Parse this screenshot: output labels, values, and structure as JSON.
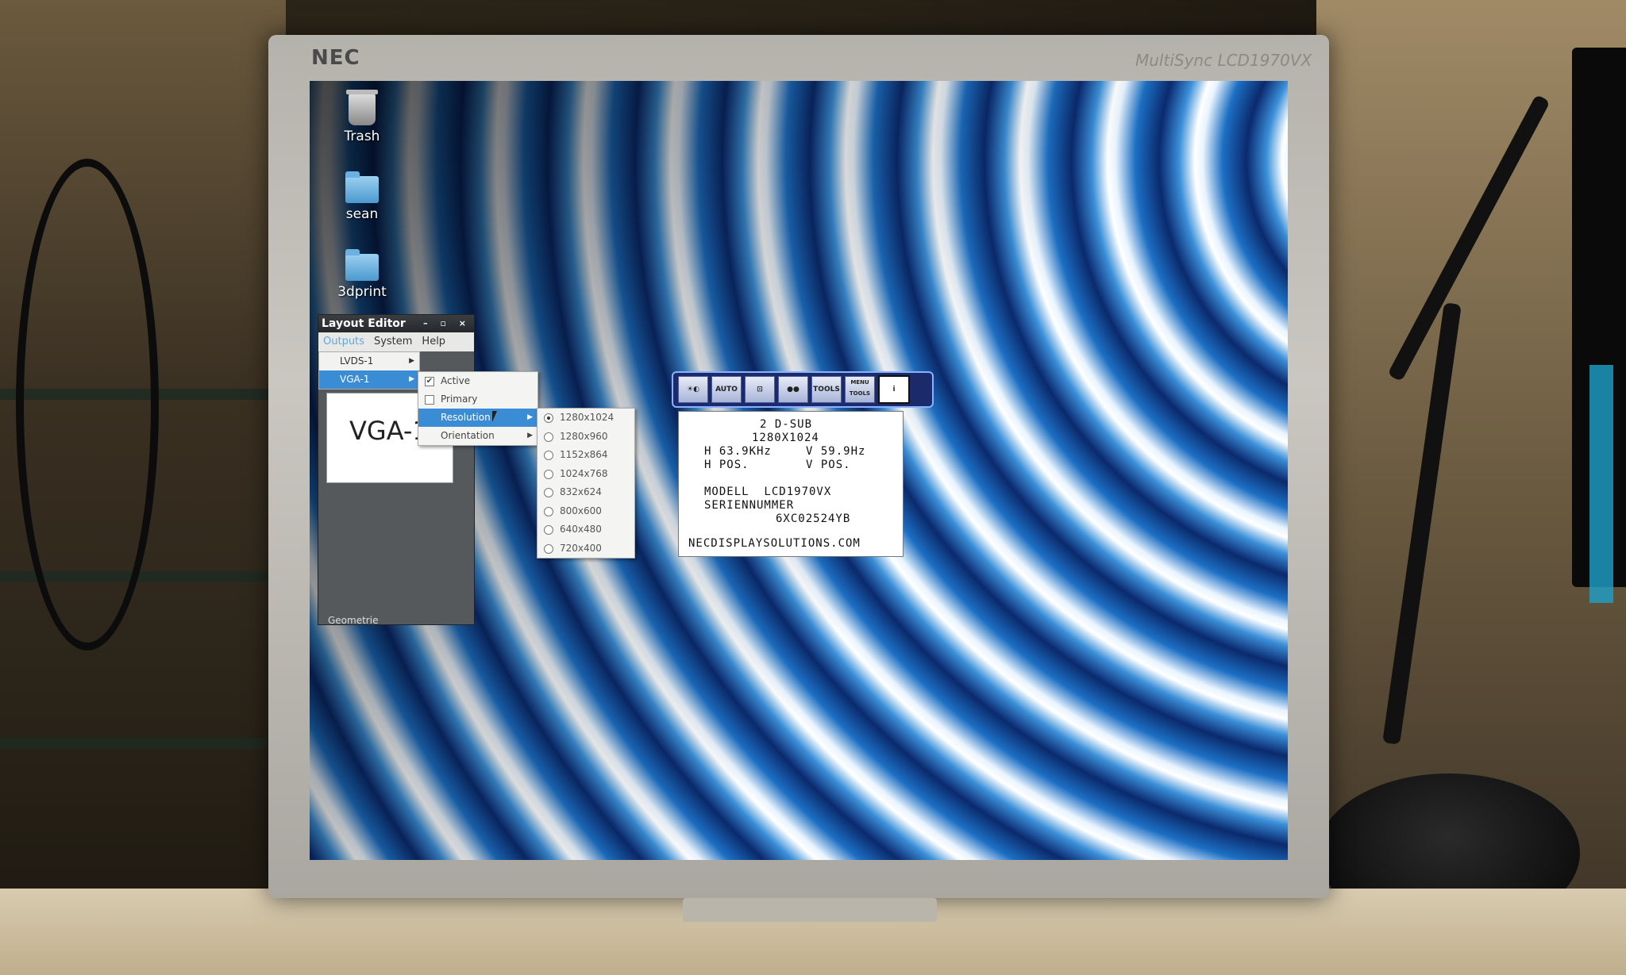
{
  "monitor": {
    "brand": "NEC",
    "model_badge": "MultiSync LCD1970VX"
  },
  "desktop": {
    "icons": [
      {
        "label": "Trash",
        "icon": "trash-icon"
      },
      {
        "label": "sean",
        "icon": "folder-icon"
      },
      {
        "label": "3dprint",
        "icon": "folder-icon"
      }
    ]
  },
  "layout_editor": {
    "title": "Layout Editor",
    "window_buttons": "– ▫ ×",
    "menus": [
      "Outputs",
      "System",
      "Help"
    ],
    "outputs": [
      {
        "label": "LVDS-1",
        "selected": false
      },
      {
        "label": "VGA-1",
        "selected": true
      }
    ],
    "canvas_label": "VGA-1",
    "status": "Geometrie"
  },
  "output_submenu": {
    "active_label": "Active",
    "active_checked": true,
    "primary_label": "Primary",
    "primary_checked": false,
    "resolution_label": "Resolution",
    "orientation_label": "Orientation"
  },
  "resolution_menu": {
    "options": [
      "1280x1024",
      "1280x960",
      "1152x864",
      "1024x768",
      "832x624",
      "800x600",
      "640x480",
      "720x400"
    ],
    "selected": "1280x1024"
  },
  "osd": {
    "buttons": [
      "brightness-icon",
      "AUTO",
      "position-icon",
      "color-icon",
      "TOOLS",
      "MENU TOOLS",
      "information-icon"
    ],
    "auto_label": "AUTO",
    "tools_label": "TOOLS",
    "menu_tools_label": "MENU TOOLS",
    "info_label": "i",
    "input": "2 D-SUB",
    "resolution": "1280X1024",
    "h_freq": "H 63.9KHz",
    "v_freq": "V 59.9Hz",
    "h_pos": "H POS.",
    "v_pos": "V POS.",
    "model": "MODELL  LCD1970VX",
    "serial_label": "SERIENNUMMER",
    "serial": "6XC02524YB",
    "website": "NECDISPLAYSOLUTIONS.COM"
  }
}
